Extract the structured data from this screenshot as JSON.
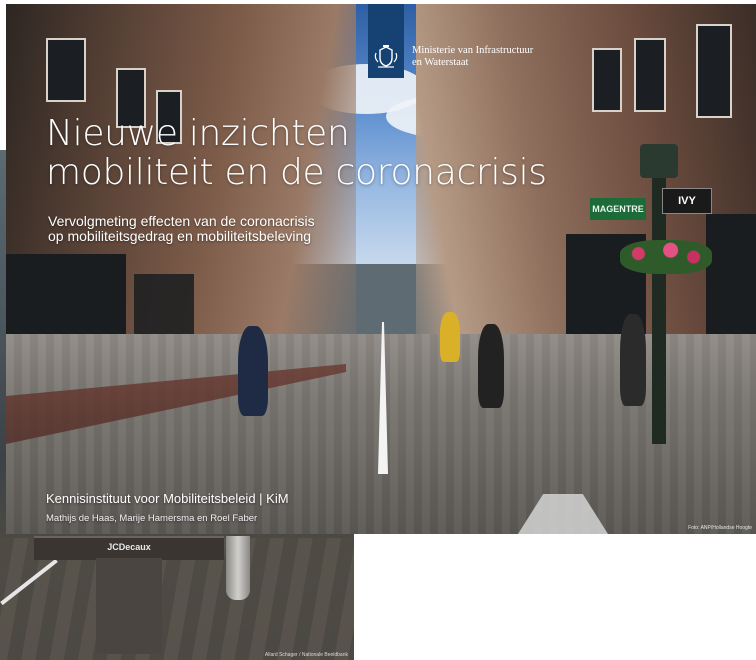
{
  "colors": {
    "gov_blue": "#154273",
    "title_text": "#ffffff",
    "shop_sign_green": "#1e6b3a"
  },
  "icons": {
    "crest": "rijkswapen-crest-icon",
    "play": "play-triangle-icon"
  },
  "background_cover": {
    "sign_text": "JCDecaux",
    "photo_credit": "Allard Schager / Nationale Beeldbank"
  },
  "main_cover": {
    "ministry": {
      "line1": "Ministerie van Infrastructuur",
      "line2": "en Waterstaat"
    },
    "title": {
      "line1": "Nieuwe inzichten",
      "line2": "mobiliteit en de coronacrisis"
    },
    "subtitle": {
      "line1": "Vervolgmeting effecten van de coronacrisis",
      "line2": "op mobiliteitsgedrag en mobiliteitsbeleving"
    },
    "institute": "Kennisinstituut voor Mobiliteitsbeleid | KiM",
    "authors": "Mathijs de Haas, Marije Hamersma en Roel Faber",
    "photo_credit": "Foto: ANP/Hollandse Hoogte",
    "scene_signs": {
      "shop": "MAGENTRE",
      "ivy": "IVY"
    }
  }
}
